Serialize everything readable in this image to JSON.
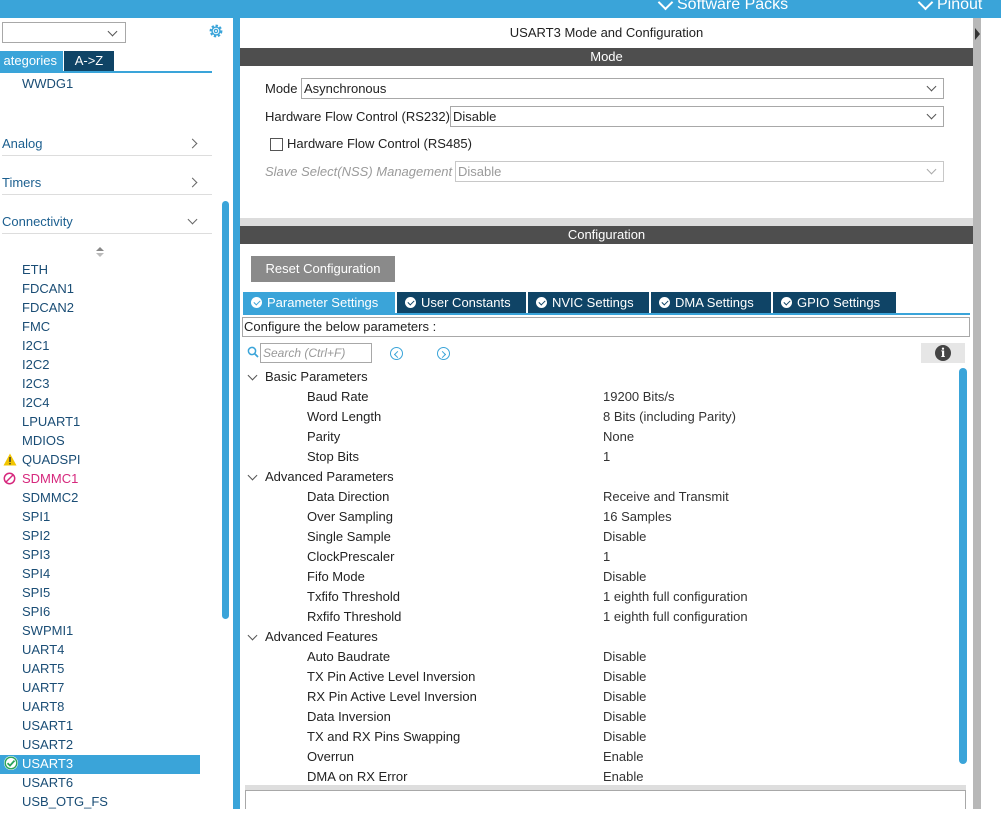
{
  "topbar": {
    "software_packs": "Software Packs",
    "pinout": "Pinout"
  },
  "left": {
    "tabs": {
      "categories": "ategories",
      "az": "A->Z"
    },
    "first_item": "WWDG1",
    "categories": [
      {
        "label": "Analog",
        "state": "collapsed"
      },
      {
        "label": "Timers",
        "state": "collapsed"
      },
      {
        "label": "Connectivity",
        "state": "expanded"
      }
    ],
    "peripherals": [
      {
        "label": "ETH",
        "status": ""
      },
      {
        "label": "FDCAN1",
        "status": ""
      },
      {
        "label": "FDCAN2",
        "status": ""
      },
      {
        "label": "FMC",
        "status": ""
      },
      {
        "label": "I2C1",
        "status": ""
      },
      {
        "label": "I2C2",
        "status": ""
      },
      {
        "label": "I2C3",
        "status": ""
      },
      {
        "label": "I2C4",
        "status": ""
      },
      {
        "label": "LPUART1",
        "status": ""
      },
      {
        "label": "MDIOS",
        "status": ""
      },
      {
        "label": "QUADSPI",
        "status": "warning"
      },
      {
        "label": "SDMMC1",
        "status": "conflict"
      },
      {
        "label": "SDMMC2",
        "status": ""
      },
      {
        "label": "SPI1",
        "status": ""
      },
      {
        "label": "SPI2",
        "status": ""
      },
      {
        "label": "SPI3",
        "status": ""
      },
      {
        "label": "SPI4",
        "status": ""
      },
      {
        "label": "SPI5",
        "status": ""
      },
      {
        "label": "SPI6",
        "status": ""
      },
      {
        "label": "SWPMI1",
        "status": ""
      },
      {
        "label": "UART4",
        "status": ""
      },
      {
        "label": "UART5",
        "status": ""
      },
      {
        "label": "UART7",
        "status": ""
      },
      {
        "label": "UART8",
        "status": ""
      },
      {
        "label": "USART1",
        "status": ""
      },
      {
        "label": "USART2",
        "status": ""
      },
      {
        "label": "USART3",
        "status": "selected"
      },
      {
        "label": "USART6",
        "status": ""
      },
      {
        "label": "USB_OTG_FS",
        "status": ""
      }
    ],
    "colors": {
      "accent": "#3aa4d9",
      "dark_tab": "#0f4466",
      "warning": "#f2c500",
      "conflict": "#d6287d"
    }
  },
  "mode_panel": {
    "title": "USART3 Mode and Configuration",
    "section": "Mode",
    "mode_label": "Mode",
    "mode_value": "Asynchronous",
    "hw_flow_232_label": "Hardware Flow Control (RS232)",
    "hw_flow_232_value": "Disable",
    "hw_flow_485_label": "Hardware Flow Control (RS485)",
    "slave_select_label": "Slave Select(NSS) Management",
    "slave_select_value": "Disable"
  },
  "config": {
    "section": "Configuration",
    "reset_button": "Reset Configuration",
    "tabs": [
      "Parameter Settings",
      "User Constants",
      "NVIC Settings",
      "DMA Settings",
      "GPIO Settings"
    ],
    "hint": "Configure the below parameters :",
    "search_placeholder": "Search (Ctrl+F)",
    "groups": [
      {
        "title": "Basic Parameters",
        "params": [
          {
            "name": "Baud Rate",
            "value": "19200 Bits/s"
          },
          {
            "name": "Word Length",
            "value": "8 Bits (including Parity)"
          },
          {
            "name": "Parity",
            "value": "None"
          },
          {
            "name": "Stop Bits",
            "value": "1"
          }
        ]
      },
      {
        "title": "Advanced Parameters",
        "params": [
          {
            "name": "Data Direction",
            "value": "Receive and Transmit"
          },
          {
            "name": "Over Sampling",
            "value": "16 Samples"
          },
          {
            "name": "Single Sample",
            "value": "Disable"
          },
          {
            "name": "ClockPrescaler",
            "value": "1"
          },
          {
            "name": "Fifo Mode",
            "value": "Disable"
          },
          {
            "name": "Txfifo Threshold",
            "value": "1 eighth full configuration"
          },
          {
            "name": "Rxfifo Threshold",
            "value": "1 eighth full configuration"
          }
        ]
      },
      {
        "title": "Advanced Features",
        "params": [
          {
            "name": "Auto Baudrate",
            "value": "Disable"
          },
          {
            "name": "TX Pin Active Level Inversion",
            "value": "Disable"
          },
          {
            "name": "RX Pin Active Level Inversion",
            "value": "Disable"
          },
          {
            "name": "Data Inversion",
            "value": "Disable"
          },
          {
            "name": "TX and RX Pins Swapping",
            "value": "Disable"
          },
          {
            "name": "Overrun",
            "value": "Enable"
          },
          {
            "name": "DMA on RX Error",
            "value": "Enable"
          }
        ]
      }
    ]
  }
}
